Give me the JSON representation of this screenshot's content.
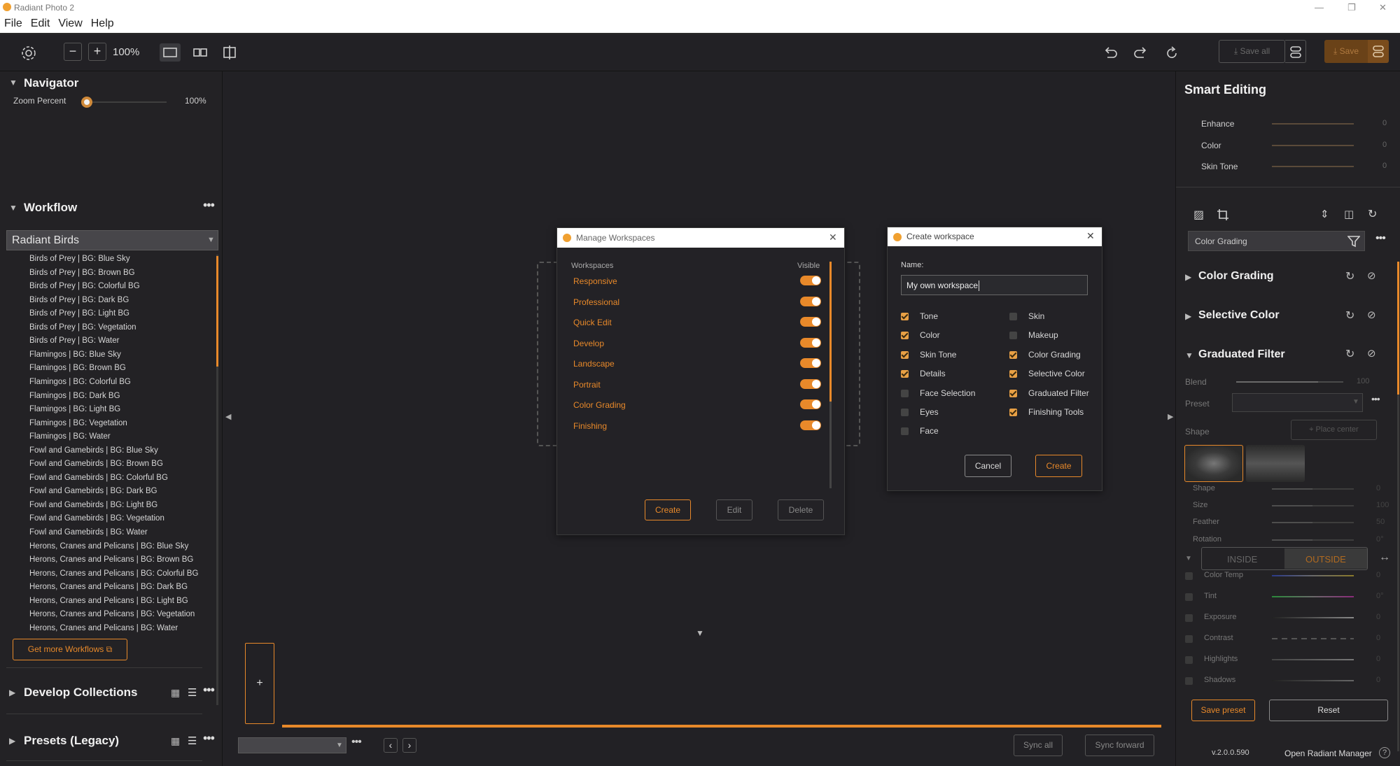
{
  "app": {
    "title": "Radiant Photo 2"
  },
  "menu": [
    "File",
    "Edit",
    "View",
    "Help"
  ],
  "toolbar": {
    "zoom": "100%",
    "save_all": "Save all",
    "save": "Save"
  },
  "navigator": {
    "title": "Navigator",
    "zoom_label": "Zoom Percent",
    "zoom_value": "100%",
    "zoom_fraction": 0.0
  },
  "workflow": {
    "title": "Workflow",
    "selected": "Radiant Birds",
    "items": [
      "Birds of Prey | BG: Blue Sky",
      "Birds of Prey | BG: Brown BG",
      "Birds of Prey | BG: Colorful BG",
      "Birds of Prey | BG: Dark BG",
      "Birds of Prey | BG: Light BG",
      "Birds of Prey | BG: Vegetation",
      "Birds of Prey | BG: Water",
      "Flamingos | BG: Blue Sky",
      "Flamingos | BG: Brown BG",
      "Flamingos | BG: Colorful BG",
      "Flamingos | BG: Dark BG",
      "Flamingos | BG: Light BG",
      "Flamingos | BG: Vegetation",
      "Flamingos | BG: Water",
      "Fowl and Gamebirds | BG: Blue Sky",
      "Fowl and Gamebirds | BG: Brown BG",
      "Fowl and Gamebirds | BG: Colorful BG",
      "Fowl and Gamebirds | BG: Dark BG",
      "Fowl and Gamebirds | BG: Light BG",
      "Fowl and Gamebirds | BG: Vegetation",
      "Fowl and Gamebirds | BG: Water",
      "Herons, Cranes and Pelicans | BG: Blue Sky",
      "Herons, Cranes and Pelicans | BG: Brown BG",
      "Herons, Cranes and Pelicans | BG: Colorful BG",
      "Herons, Cranes and Pelicans | BG: Dark BG",
      "Herons, Cranes and Pelicans | BG: Light BG",
      "Herons, Cranes and Pelicans | BG: Vegetation",
      "Herons, Cranes and Pelicans | BG: Water"
    ],
    "get_more": "Get more Workflows"
  },
  "develop_collections": {
    "title": "Develop Collections"
  },
  "presets_legacy": {
    "title": "Presets (Legacy)"
  },
  "manage_workspaces": {
    "title": "Manage Workspaces",
    "col_workspaces": "Workspaces",
    "col_visible": "Visible",
    "items": [
      "Responsive",
      "Professional",
      "Quick Edit",
      "Develop",
      "Landscape",
      "Portrait",
      "Color Grading",
      "Finishing"
    ],
    "create": "Create",
    "edit": "Edit",
    "delete": "Delete"
  },
  "create_workspace": {
    "title": "Create workspace",
    "name_label": "Name:",
    "name_value": "My own workspace",
    "left_options": [
      {
        "label": "Tone",
        "checked": true
      },
      {
        "label": "Color",
        "checked": true
      },
      {
        "label": "Skin Tone",
        "checked": true
      },
      {
        "label": "Details",
        "checked": true
      },
      {
        "label": "Face Selection",
        "checked": false
      },
      {
        "label": "Eyes",
        "checked": false
      },
      {
        "label": "Face",
        "checked": false
      }
    ],
    "right_options": [
      {
        "label": "Skin",
        "checked": false
      },
      {
        "label": "Makeup",
        "checked": false
      },
      {
        "label": "Color Grading",
        "checked": true
      },
      {
        "label": "Selective Color",
        "checked": true
      },
      {
        "label": "Graduated Filter",
        "checked": true
      },
      {
        "label": "Finishing Tools",
        "checked": true
      }
    ],
    "cancel": "Cancel",
    "create": "Create"
  },
  "bottom": {
    "add": "+",
    "sync_all": "Sync all",
    "sync_forward": "Sync forward"
  },
  "smart_editing": {
    "title": "Smart Editing",
    "sliders": [
      {
        "label": "Enhance",
        "value": "0"
      },
      {
        "label": "Color",
        "value": "0"
      },
      {
        "label": "Skin Tone",
        "value": "0"
      }
    ]
  },
  "workspace_select": "Color Grading",
  "sections": {
    "color_grading": "Color Grading",
    "selective_color": "Selective Color",
    "graduated_filter": "Graduated Filter"
  },
  "graduated": {
    "blend_label": "Blend",
    "blend_value": "100",
    "preset_label": "Preset",
    "shape_label": "Shape",
    "place_center": "Place center",
    "shape_sliders": [
      {
        "label": "Shape",
        "value": "0"
      },
      {
        "label": "Size",
        "value": "100"
      },
      {
        "label": "Feather",
        "value": "50"
      },
      {
        "label": "Rotation",
        "value": "0°"
      }
    ],
    "inside": "INSIDE",
    "outside": "OUTSIDE",
    "adjust_sliders": [
      {
        "label": "Color Temp",
        "value": "0"
      },
      {
        "label": "Tint",
        "value": "0°"
      },
      {
        "label": "Exposure",
        "value": "0"
      },
      {
        "label": "Contrast",
        "value": "0"
      },
      {
        "label": "Highlights",
        "value": "0"
      },
      {
        "label": "Shadows",
        "value": "0"
      }
    ],
    "save_preset": "Save preset",
    "reset": "Reset"
  },
  "footer": {
    "version": "v.2.0.0.590",
    "manager": "Open Radiant Manager",
    "help": "?"
  },
  "colors": {
    "accent": "#e8892a",
    "background": "#222125",
    "panel": "#232225"
  }
}
